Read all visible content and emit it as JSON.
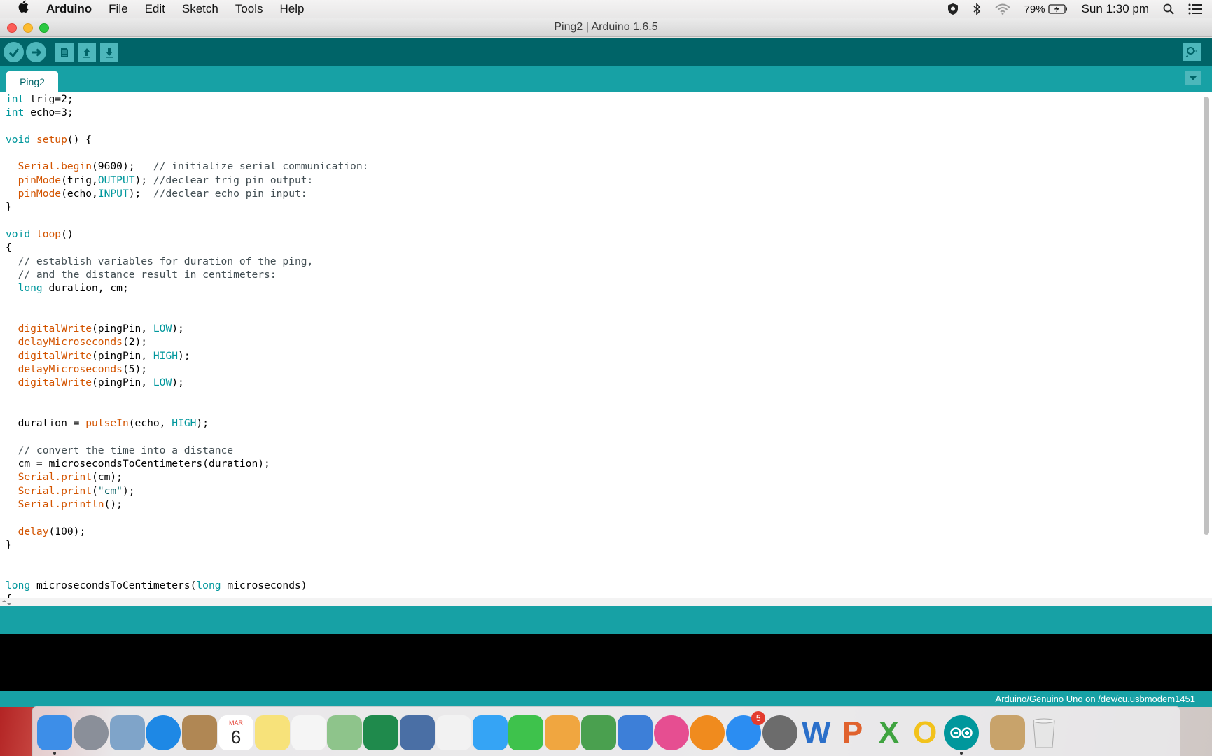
{
  "menubar": {
    "app_name": "Arduino",
    "items": [
      "File",
      "Edit",
      "Sketch",
      "Tools",
      "Help"
    ],
    "battery": "79%",
    "clock": "Sun 1:30 pm"
  },
  "window": {
    "title": "Ping2 | Arduino 1.6.5"
  },
  "tabs": [
    {
      "label": "Ping2"
    }
  ],
  "code_lines": [
    [
      [
        "kw",
        "int"
      ],
      [
        "",
        " trig=2;"
      ]
    ],
    [
      [
        "kw",
        "int"
      ],
      [
        "",
        " echo=3;"
      ]
    ],
    [],
    [
      [
        "kw",
        "void"
      ],
      [
        "",
        " "
      ],
      [
        "fn",
        "setup"
      ],
      [
        "",
        "() {"
      ]
    ],
    [],
    [
      [
        "",
        "  "
      ],
      [
        "fn",
        "Serial.begin"
      ],
      [
        "",
        "(9600);   "
      ],
      [
        "cm",
        "// initialize serial communication:"
      ]
    ],
    [
      [
        "",
        "  "
      ],
      [
        "fn",
        "pinMode"
      ],
      [
        "",
        "(trig,"
      ],
      [
        "cs",
        "OUTPUT"
      ],
      [
        "",
        "); "
      ],
      [
        "cm",
        "//declear trig pin output:"
      ]
    ],
    [
      [
        "",
        "  "
      ],
      [
        "fn",
        "pinMode"
      ],
      [
        "",
        "(echo,"
      ],
      [
        "cs",
        "INPUT"
      ],
      [
        "",
        ");  "
      ],
      [
        "cm",
        "//declear echo pin input:"
      ]
    ],
    [
      [
        "",
        "}"
      ]
    ],
    [],
    [
      [
        "kw",
        "void"
      ],
      [
        "",
        " "
      ],
      [
        "fn",
        "loop"
      ],
      [
        "",
        "()"
      ]
    ],
    [
      [
        "",
        "{"
      ]
    ],
    [
      [
        "",
        "  "
      ],
      [
        "cm",
        "// establish variables for duration of the ping,"
      ]
    ],
    [
      [
        "",
        "  "
      ],
      [
        "cm",
        "// and the distance result in centimeters:"
      ]
    ],
    [
      [
        "",
        "  "
      ],
      [
        "kw",
        "long"
      ],
      [
        "",
        " duration, cm;"
      ]
    ],
    [],
    [],
    [
      [
        "",
        "  "
      ],
      [
        "fn",
        "digitalWrite"
      ],
      [
        "",
        "(pingPin, "
      ],
      [
        "cs",
        "LOW"
      ],
      [
        "",
        ");"
      ]
    ],
    [
      [
        "",
        "  "
      ],
      [
        "fn",
        "delayMicroseconds"
      ],
      [
        "",
        "(2);"
      ]
    ],
    [
      [
        "",
        "  "
      ],
      [
        "fn",
        "digitalWrite"
      ],
      [
        "",
        "(pingPin, "
      ],
      [
        "cs",
        "HIGH"
      ],
      [
        "",
        ");"
      ]
    ],
    [
      [
        "",
        "  "
      ],
      [
        "fn",
        "delayMicroseconds"
      ],
      [
        "",
        "(5);"
      ]
    ],
    [
      [
        "",
        "  "
      ],
      [
        "fn",
        "digitalWrite"
      ],
      [
        "",
        "(pingPin, "
      ],
      [
        "cs",
        "LOW"
      ],
      [
        "",
        ");"
      ]
    ],
    [],
    [],
    [
      [
        "",
        "  duration = "
      ],
      [
        "fn",
        "pulseIn"
      ],
      [
        "",
        "(echo, "
      ],
      [
        "cs",
        "HIGH"
      ],
      [
        "",
        ");"
      ]
    ],
    [],
    [
      [
        "",
        "  "
      ],
      [
        "cm",
        "// convert the time into a distance"
      ]
    ],
    [
      [
        "",
        "  cm = microsecondsToCentimeters(duration);"
      ]
    ],
    [
      [
        "",
        "  "
      ],
      [
        "fn",
        "Serial.print"
      ],
      [
        "",
        "(cm);"
      ]
    ],
    [
      [
        "",
        "  "
      ],
      [
        "fn",
        "Serial.print"
      ],
      [
        "",
        "("
      ],
      [
        "st",
        "\"cm\""
      ],
      [
        "",
        ");"
      ]
    ],
    [
      [
        "",
        "  "
      ],
      [
        "fn",
        "Serial.println"
      ],
      [
        "",
        "();"
      ]
    ],
    [],
    [
      [
        "",
        "  "
      ],
      [
        "fn",
        "delay"
      ],
      [
        "",
        "(100);"
      ]
    ],
    [
      [
        "",
        "}"
      ]
    ],
    [],
    [],
    [
      [
        "kw",
        "long"
      ],
      [
        "",
        " microsecondsToCentimeters("
      ],
      [
        "kw",
        "long"
      ],
      [
        "",
        " microseconds)"
      ]
    ],
    [
      [
        "",
        "{"
      ]
    ]
  ],
  "footer": {
    "board_port": "Arduino/Genuino Uno on /dev/cu.usbmodem1451"
  },
  "dock": {
    "calendar_month": "MAR",
    "calendar_day": "6",
    "app_store_badge": "5",
    "icons": [
      {
        "name": "finder-icon",
        "color": "#3d8ee8"
      },
      {
        "name": "launchpad-icon",
        "color": "#8a8f99"
      },
      {
        "name": "mail-stamp-icon",
        "color": "#7fa4c9"
      },
      {
        "name": "safari-icon",
        "color": "#1e88e5"
      },
      {
        "name": "contacts-icon",
        "color": "#b08754"
      },
      {
        "name": "calendar-icon",
        "color": "#ffffff"
      },
      {
        "name": "notes-icon",
        "color": "#f7e27a"
      },
      {
        "name": "reminders-icon",
        "color": "#f5f5f5"
      },
      {
        "name": "maps-icon",
        "color": "#8ec48b"
      },
      {
        "name": "shield-security-icon",
        "color": "#1f8a4c"
      },
      {
        "name": "network-icon",
        "color": "#4a6fa5"
      },
      {
        "name": "photos-icon",
        "color": "#f2f2f2"
      },
      {
        "name": "messages-icon",
        "color": "#35a4f5"
      },
      {
        "name": "facetime-icon",
        "color": "#3ec24c"
      },
      {
        "name": "pages-icon",
        "color": "#f0a640"
      },
      {
        "name": "numbers-icon",
        "color": "#4aa04f"
      },
      {
        "name": "keynote-icon",
        "color": "#3d7fd8"
      },
      {
        "name": "itunes-icon",
        "color": "#e64e91"
      },
      {
        "name": "ibooks-icon",
        "color": "#f08b1e"
      },
      {
        "name": "app-store-icon",
        "color": "#2b8df2"
      },
      {
        "name": "system-preferences-icon",
        "color": "#6c6c6c"
      },
      {
        "name": "word-icon",
        "color": "#2b6fc9"
      },
      {
        "name": "powerpoint-icon",
        "color": "#e0622e"
      },
      {
        "name": "excel-icon",
        "color": "#3fa340"
      },
      {
        "name": "outlook-icon",
        "color": "#f2c21b"
      },
      {
        "name": "arduino-icon",
        "color": "#00979c"
      },
      {
        "name": "downloads-stack-icon",
        "color": "#c8a36b"
      },
      {
        "name": "trash-icon",
        "color": "#dadada"
      }
    ]
  }
}
